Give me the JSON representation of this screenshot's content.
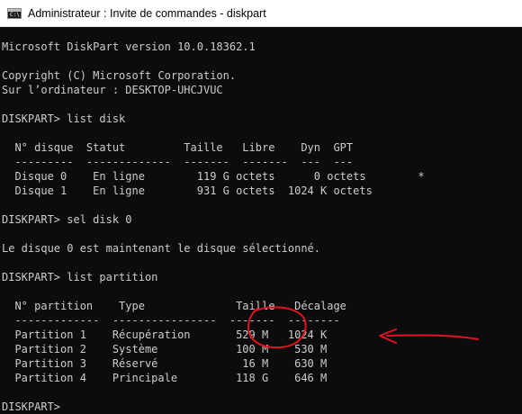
{
  "window": {
    "title": "Administrateur : Invite de commandes - diskpart",
    "icon": "cmd-icon"
  },
  "console": {
    "lines": [
      "Microsoft DiskPart version 10.0.18362.1",
      "",
      "Copyright (C) Microsoft Corporation.",
      "Sur l’ordinateur : DESKTOP-UHCJVUC",
      "",
      "DISKPART> list disk",
      "",
      "  N° disque  Statut         Taille   Libre    Dyn  GPT",
      "  ---------  -------------  -------  -------  ---  ---",
      "  Disque 0    En ligne        119 G octets      0 octets        *",
      "  Disque 1    En ligne        931 G octets  1024 K octets",
      "",
      "DISKPART> sel disk 0",
      "",
      "Le disque 0 est maintenant le disque sélectionné.",
      "",
      "DISKPART> list partition",
      "",
      "  N° partition    Type              Taille   Décalage",
      "  -------------  ----------------  -------  --------",
      "  Partition 1    Récupération       529 M   1024 K",
      "  Partition 2    Système            100 M    530 M",
      "  Partition 3    Réservé             16 M    630 M",
      "  Partition 4    Principale         118 G    646 M",
      "",
      "DISKPART> "
    ]
  },
  "annotation": {
    "color": "#e0141e",
    "circle_target": "Partition 1 Taille 529 M",
    "arrow_target": "Partition 1 Décalage 1024 K"
  }
}
